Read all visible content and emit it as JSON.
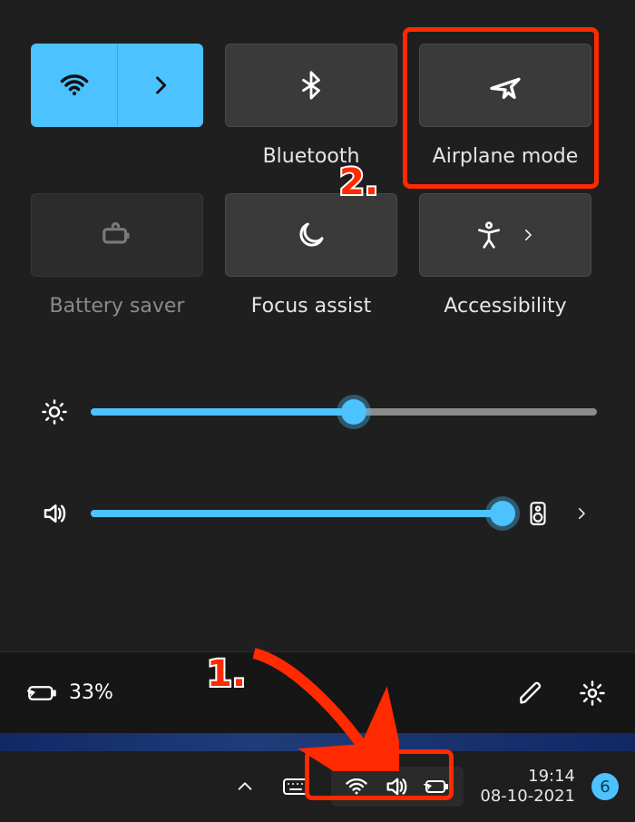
{
  "colors": {
    "accent": "#4cc2ff",
    "callout": "#ff2a00"
  },
  "tiles": {
    "wifi": {
      "label": ""
    },
    "bluetooth": {
      "label": "Bluetooth"
    },
    "airplane": {
      "label": "Airplane mode"
    },
    "battery_saver": {
      "label": "Battery saver"
    },
    "focus_assist": {
      "label": "Focus assist"
    },
    "accessibility": {
      "label": "Accessibility"
    }
  },
  "sliders": {
    "brightness_pct": 52,
    "volume_pct": 100
  },
  "footer": {
    "battery_pct": "33%"
  },
  "taskbar": {
    "time": "19:14",
    "date": "08-10-2021",
    "notification_count": "6"
  },
  "annotations": {
    "step1": "1.",
    "step2": "2."
  }
}
